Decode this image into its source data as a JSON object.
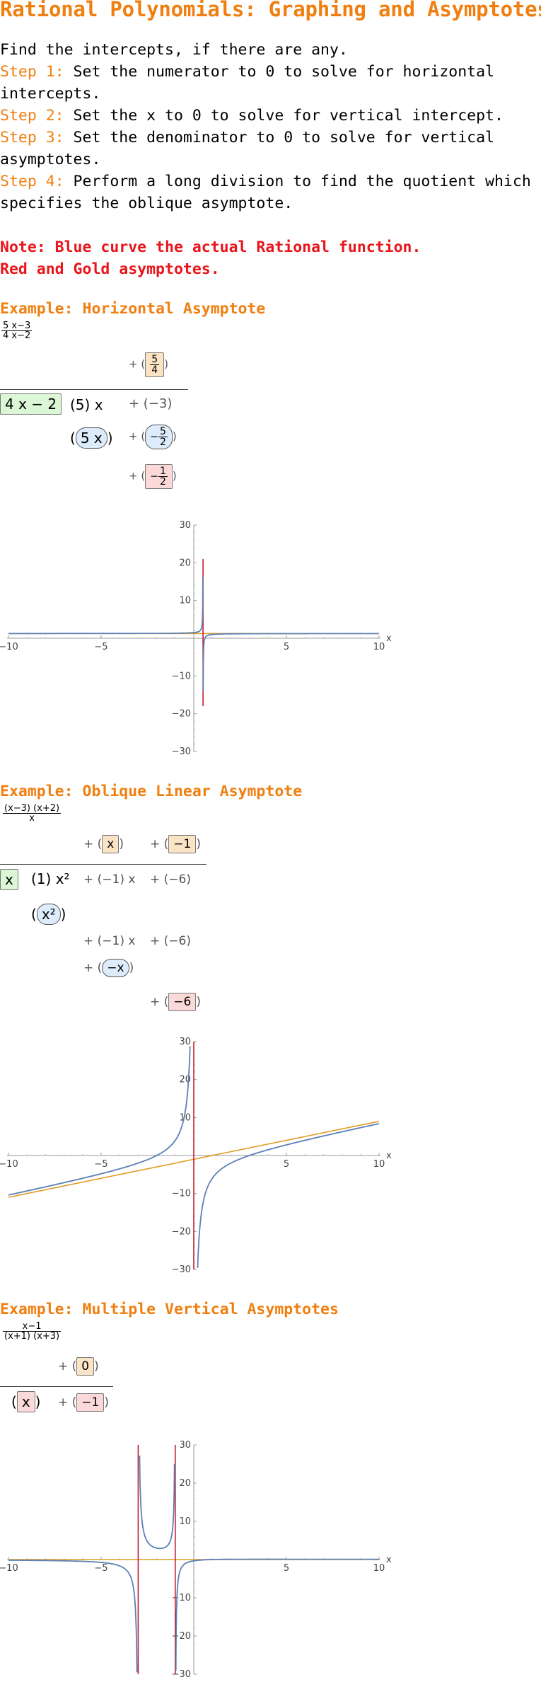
{
  "title": "Rational Polynomials: Graphing and Asymptotes",
  "intro": {
    "line1": "Find the intercepts, if there are any.",
    "steps": [
      {
        "label": "Step 1:",
        "text": " Set the numerator to 0 to solve for horizontal",
        "cont": "intercepts."
      },
      {
        "label": "Step 2:",
        "text": " Set the x to 0 to solve for vertical intercept.",
        "cont": ""
      },
      {
        "label": "Step 3:",
        "text": " Set the denominator to 0 to solve for vertical",
        "cont": "asymptotes."
      },
      {
        "label": "Step 4:",
        "text": " Perform a long division to find the quotient which",
        "cont": "specifies the oblique asymptote."
      }
    ],
    "note1": "Note: Blue curve the actual Rational function.",
    "note2": "Red and Gold asymptotes."
  },
  "examples": [
    {
      "heading": "Example: Horizontal Asymptote",
      "function": {
        "num": "5 x−3",
        "den": "4 x−2"
      },
      "division": {
        "quotient": "5/4",
        "divisor": "4 x − 2",
        "dividend": [
          "(5) x",
          "+ (−3)"
        ],
        "subtract": "5 x",
        "subtract_const": "−5/2",
        "remainder": "−1/2"
      }
    },
    {
      "heading": "Example: Oblique Linear Asymptote",
      "function": {
        "num": "(x−3) (x+2)",
        "den": "x"
      },
      "division": {
        "quotient": [
          "x",
          "−1"
        ],
        "divisor": "x",
        "dividend": [
          "(1) x²",
          "+ (−1) x",
          "+ (−6)"
        ],
        "subtract1": "x²",
        "row3": [
          "+ (−1) x",
          "+ (−6)"
        ],
        "subtract2": "−x",
        "remainder": "−6"
      }
    },
    {
      "heading": "Example: Multiple Vertical Asymptotes",
      "function": {
        "num": "x−1",
        "den": "(x+1) (x+3)"
      },
      "division": {
        "quotient": "0",
        "divisor": "x",
        "remainder": "−1"
      }
    }
  ],
  "chart_data": [
    {
      "type": "line",
      "xlim": [
        -10,
        10
      ],
      "ylim": [
        -30,
        30
      ],
      "xlabel": "x",
      "x_ticks": [
        "−10",
        "−5",
        "5",
        "10"
      ],
      "y_ticks": [
        "30",
        "20",
        "10",
        "−10",
        "−20",
        "−30"
      ],
      "series": [
        {
          "function": "(5x-3)/(4x-2)",
          "color": "#5e81b5",
          "vertical_asymptote": 0.5,
          "y_clip": [
            -18,
            21
          ]
        },
        {
          "function": "y = 5/4",
          "color": "#e19c24"
        },
        {
          "function": "x = 1/2",
          "color": "#c02030",
          "y_range": [
            -18,
            21
          ]
        }
      ]
    },
    {
      "type": "line",
      "xlim": [
        -10,
        10
      ],
      "ylim": [
        -30,
        30
      ],
      "xlabel": "x",
      "x_ticks": [
        "−10",
        "−5",
        "5",
        "10"
      ],
      "y_ticks": [
        "30",
        "20",
        "10",
        "−10",
        "−20",
        "−30"
      ],
      "series": [
        {
          "function": "((x-3)(x+2))/x",
          "color": "#5e81b5",
          "vertical_asymptote": 0
        },
        {
          "function": "y = x - 1",
          "color": "#e19c24"
        },
        {
          "function": "x = 0",
          "color": "#c02030",
          "y_range": [
            -30,
            30
          ]
        }
      ]
    },
    {
      "type": "line",
      "xlim": [
        -10,
        10
      ],
      "ylim": [
        -30,
        30
      ],
      "xlabel": "x",
      "x_ticks": [
        "−10",
        "−5",
        "5",
        "10"
      ],
      "y_ticks": [
        "30",
        "20",
        "10",
        "−10",
        "−20",
        "−30"
      ],
      "series": [
        {
          "function": "(x-1)/((x+1)(x+3))",
          "color": "#5e81b5",
          "vertical_asymptotes": [
            -3,
            -1
          ]
        },
        {
          "function": "y = 0",
          "color": "#e19c24"
        },
        {
          "function": "x = -3",
          "color": "#c02030",
          "y_range": [
            -30,
            30
          ]
        },
        {
          "function": "x = -1",
          "color": "#c02030",
          "y_range": [
            -30,
            30
          ]
        }
      ]
    }
  ]
}
